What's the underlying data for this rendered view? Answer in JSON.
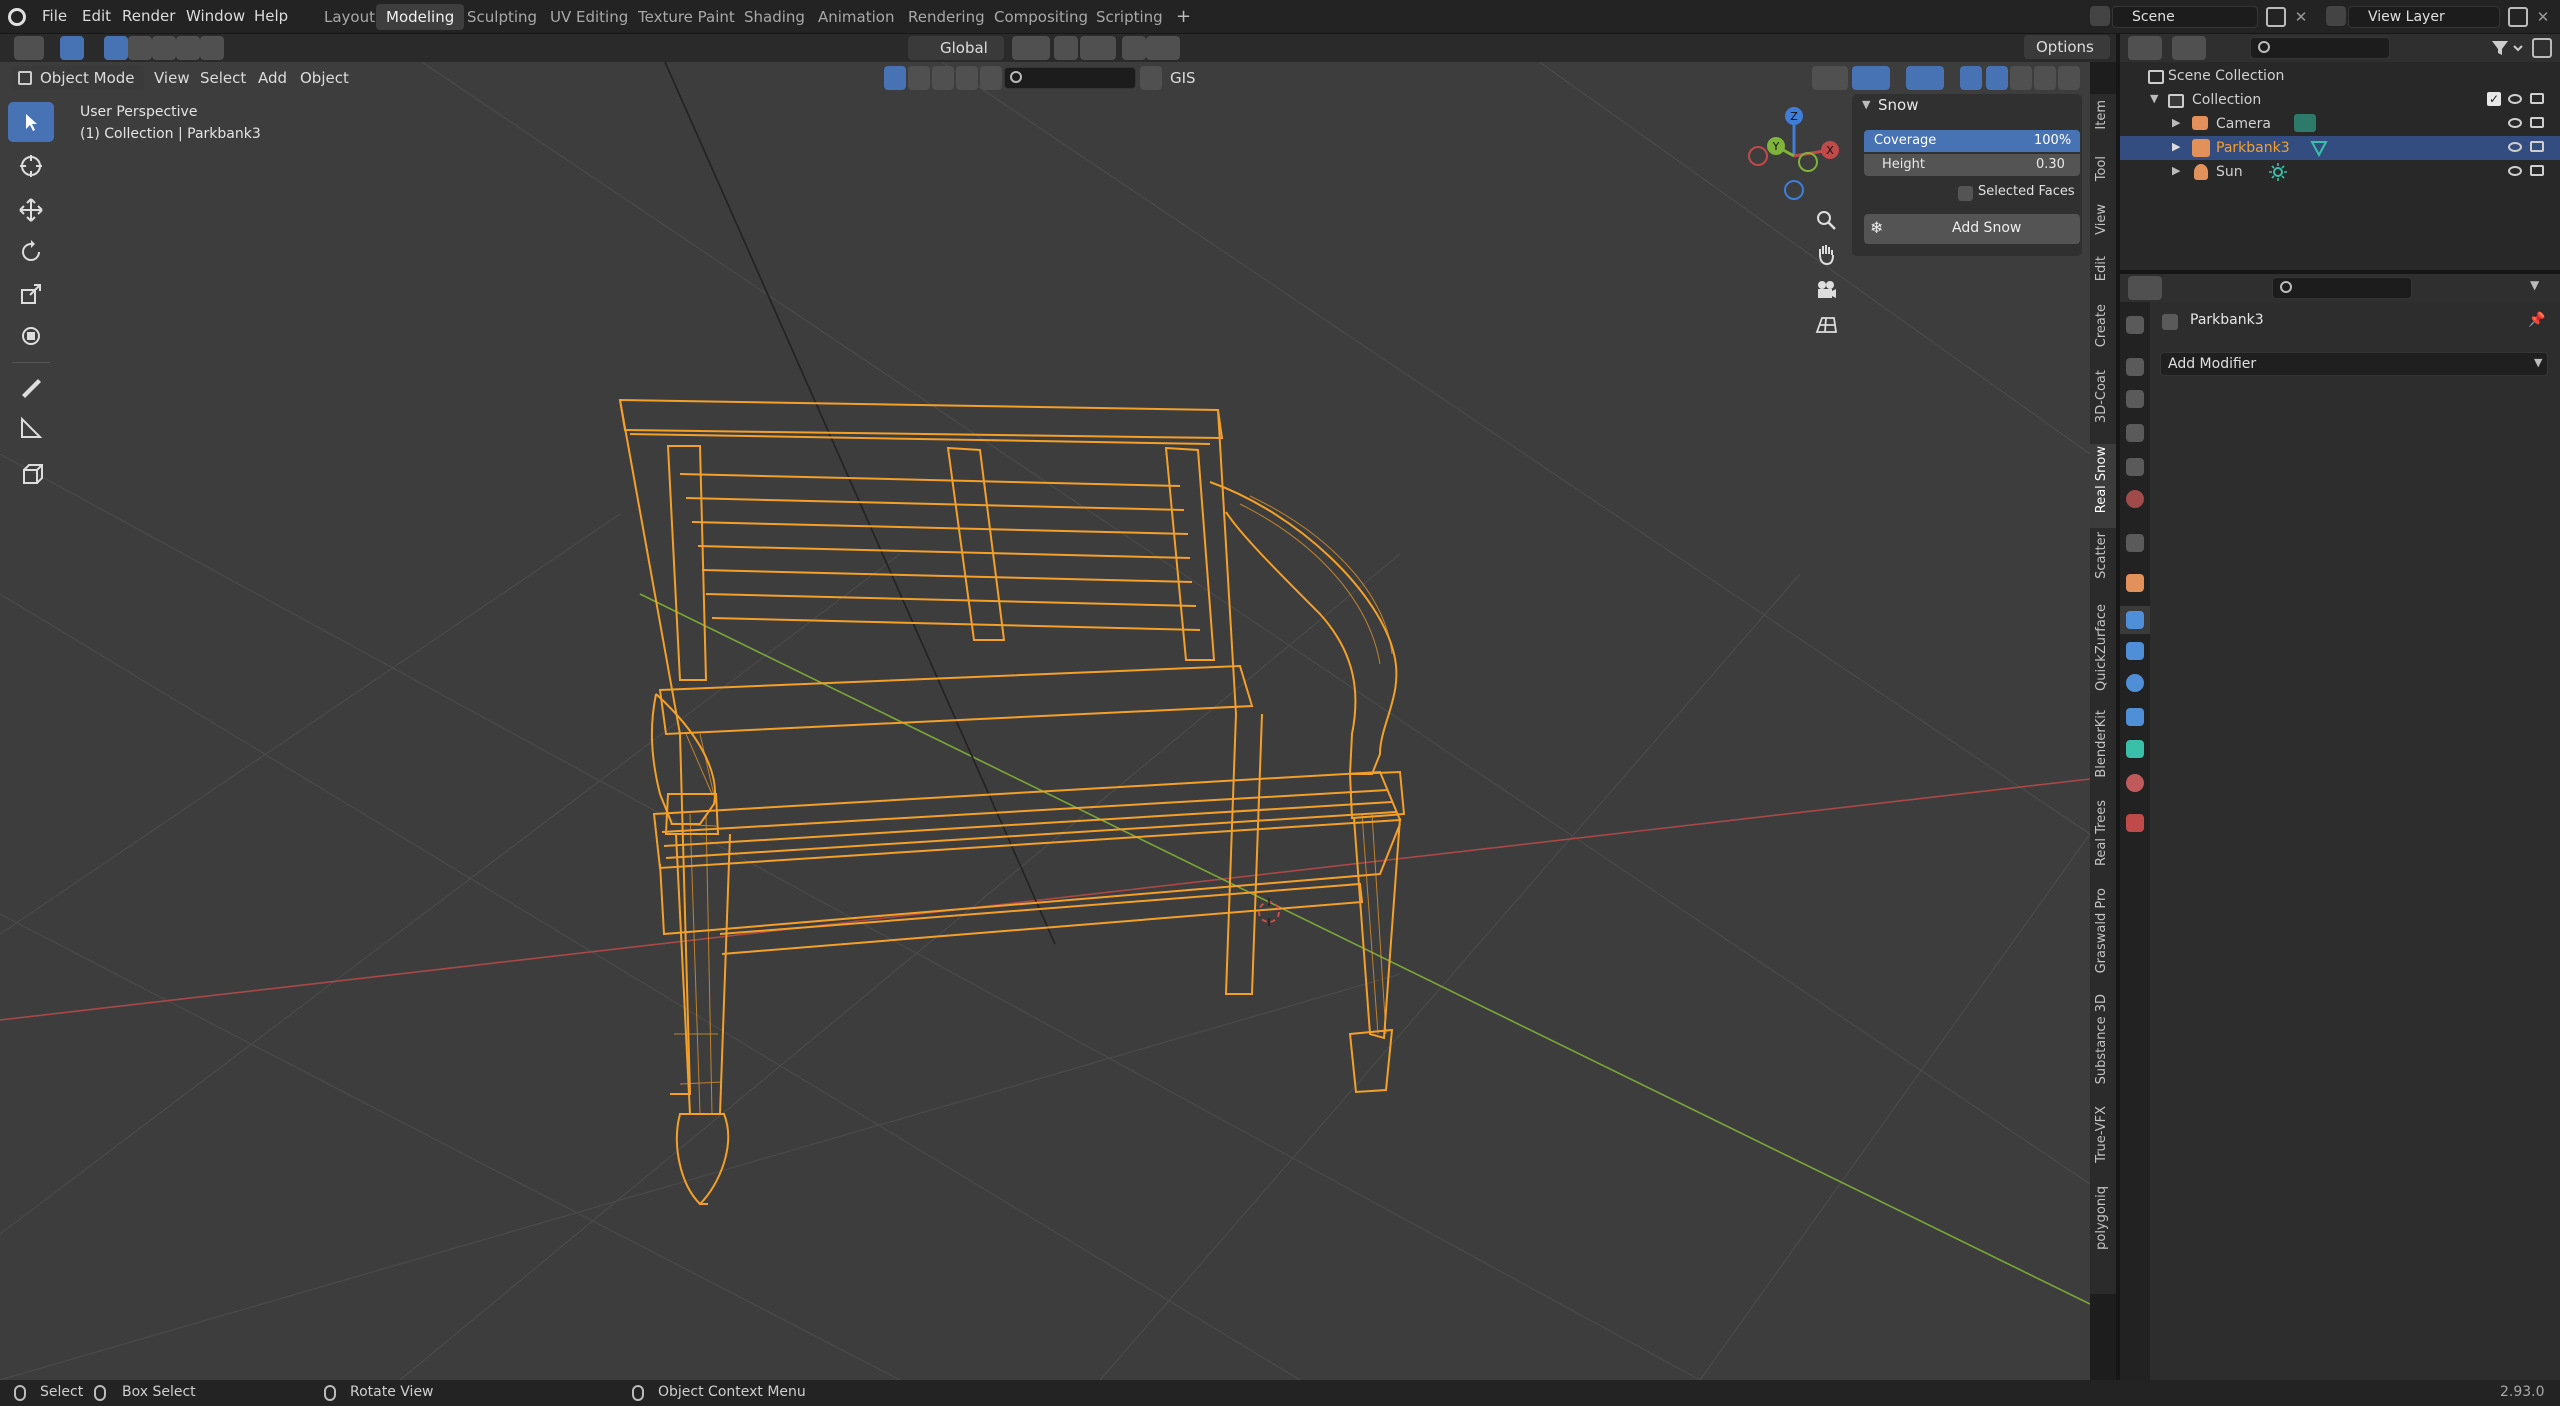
{
  "menubar": {
    "items": [
      "File",
      "Edit",
      "Render",
      "Window",
      "Help"
    ],
    "workspaces": [
      "Layout",
      "Modeling",
      "Sculpting",
      "UV Editing",
      "Texture Paint",
      "Shading",
      "Animation",
      "Rendering",
      "Compositing",
      "Scripting"
    ],
    "active_workspace": "Modeling",
    "add_tab": "+",
    "scene": "Scene",
    "view_layer": "View Layer"
  },
  "header_bar": {
    "transform_orientation": "Global",
    "options": "Options"
  },
  "viewport_header": {
    "mode": "Object Mode",
    "menus": [
      "View",
      "Select",
      "Add",
      "Object"
    ],
    "gis": "GIS"
  },
  "viewport": {
    "perspective": "User Perspective",
    "collection_info": "(1) Collection | Parkbank3"
  },
  "gizmo": {
    "z": "Z",
    "y": "Y",
    "x": "X"
  },
  "snow_panel": {
    "title": "Snow",
    "coverage_label": "Coverage",
    "coverage_value": "100%",
    "height_label": "Height",
    "height_value": "0.30",
    "selected_faces": "Selected Faces",
    "add_snow": "Add Snow"
  },
  "sidebar_tabs": [
    "Item",
    "Tool",
    "View",
    "Edit",
    "Create",
    "3D-Coat",
    "Real Snow",
    "Scatter",
    "QuickZurface",
    "BlenderKit",
    "Real Trees",
    "Graswald Pro",
    "Substance 3D",
    "True-VFX",
    "polygoniq"
  ],
  "active_sidebar_tab": "Real Snow",
  "outliner": {
    "scene_collection": "Scene Collection",
    "collection": "Collection",
    "items": [
      {
        "name": "Camera",
        "selected": false
      },
      {
        "name": "Parkbank3",
        "selected": true
      },
      {
        "name": "Sun",
        "selected": false
      }
    ]
  },
  "properties": {
    "object_name": "Parkbank3",
    "add_modifier": "Add Modifier"
  },
  "statusbar": {
    "select": "Select",
    "box_select": "Box Select",
    "rotate_view": "Rotate View",
    "context_menu": "Object Context Menu",
    "version": "2.93.0"
  },
  "colors": {
    "accent": "#4772b3",
    "selection_orange": "#f3a02a",
    "x_axis": "#c04a4a",
    "y_axis": "#7fb33a",
    "z_axis": "#3f7ed8"
  }
}
